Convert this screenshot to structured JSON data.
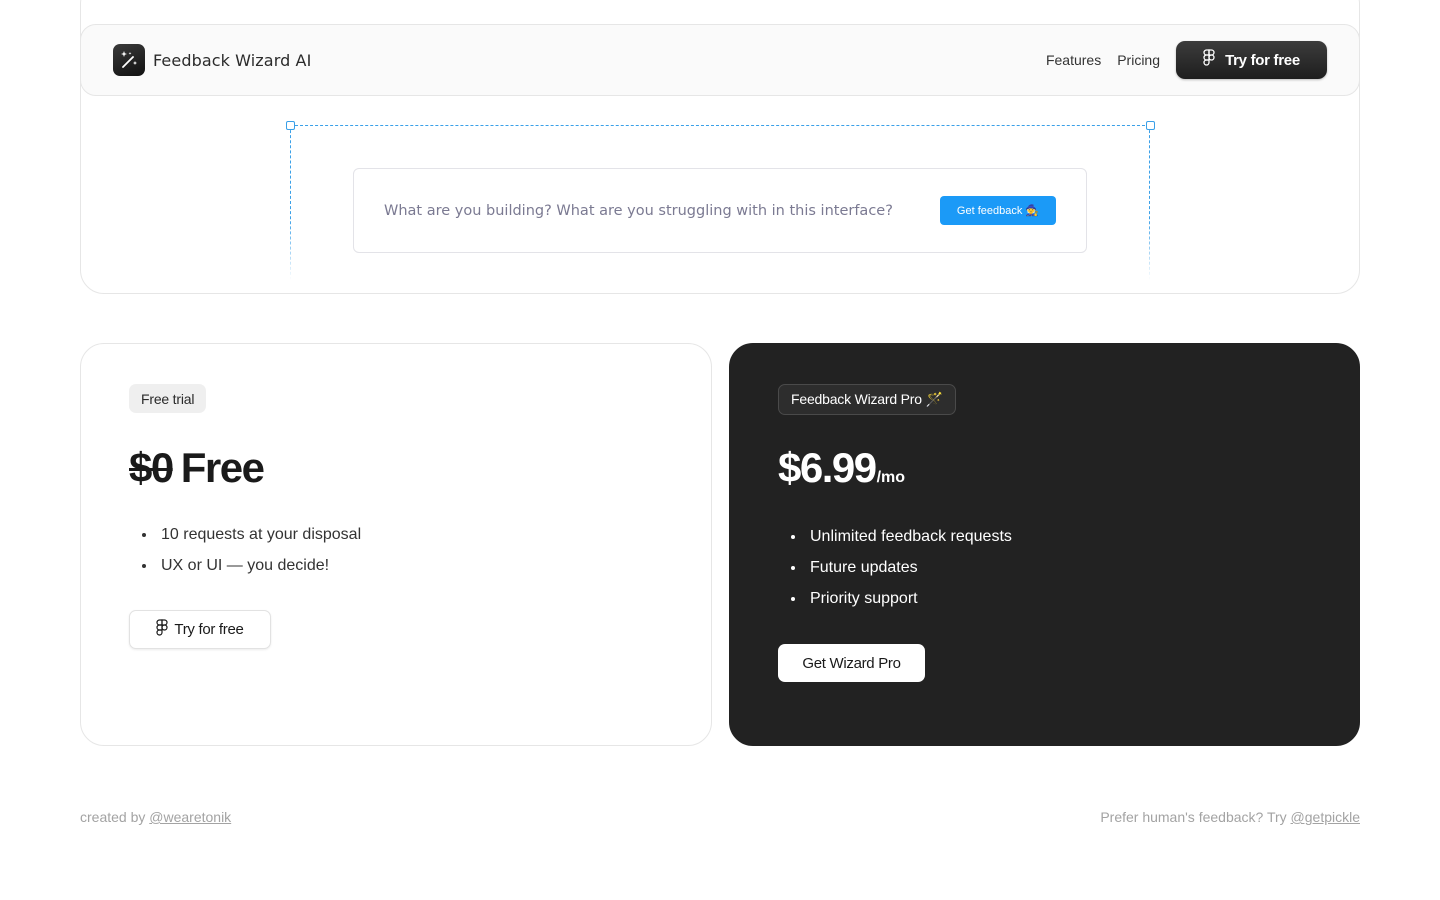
{
  "header": {
    "brand_name": "Feedback Wizard AI",
    "logo_icon": "magic-wand-icon",
    "nav": [
      {
        "label": "Features"
      },
      {
        "label": "Pricing"
      }
    ],
    "cta_label": "Try for free",
    "cta_icon": "figma-icon"
  },
  "prompt": {
    "placeholder": "What are you building? What are you struggling with in this interface?",
    "button_label": "Get feedback",
    "button_emoji": "🧙",
    "accent_color": "#1b9af7",
    "selection_color": "#3aa0e8"
  },
  "pricing": {
    "free": {
      "badge": "Free trial",
      "price_struck": "$0",
      "price_label": "Free",
      "features": [
        "10 requests at your disposal",
        "UX or UI — you decide!"
      ],
      "button_label": "Try for free",
      "button_icon": "figma-icon"
    },
    "pro": {
      "badge": "Feedback Wizard Pro 🪄",
      "price": "$6.99",
      "period": "/mo",
      "features": [
        "Unlimited feedback requests",
        "Future updates",
        "Priority support"
      ],
      "button_label": "Get Wizard Pro",
      "background": "#222222"
    }
  },
  "footer": {
    "left_prefix": "created by ",
    "left_link": "@wearetonik",
    "right_prefix": "Prefer human's feedback? Try ",
    "right_link": "@getpickle"
  }
}
